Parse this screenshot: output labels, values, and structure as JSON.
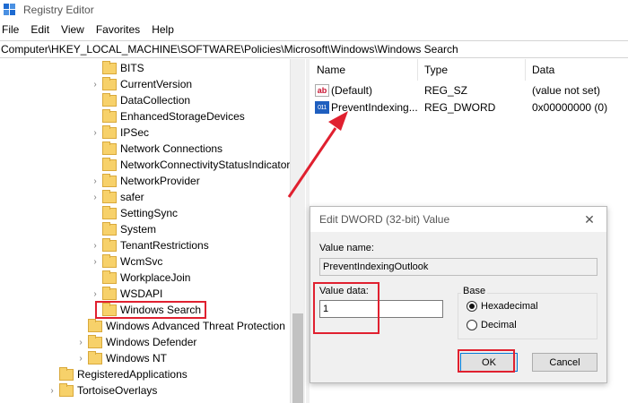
{
  "window": {
    "title": "Registry Editor"
  },
  "menu": [
    "File",
    "Edit",
    "View",
    "Favorites",
    "Help"
  ],
  "address": "Computer\\HKEY_LOCAL_MACHINE\\SOFTWARE\\Policies\\Microsoft\\Windows\\Windows Search",
  "tree": [
    {
      "label": "BITS",
      "chev": ""
    },
    {
      "label": "CurrentVersion",
      "chev": "›"
    },
    {
      "label": "DataCollection",
      "chev": ""
    },
    {
      "label": "EnhancedStorageDevices",
      "chev": ""
    },
    {
      "label": "IPSec",
      "chev": "›"
    },
    {
      "label": "Network Connections",
      "chev": ""
    },
    {
      "label": "NetworkConnectivityStatusIndicator",
      "chev": ""
    },
    {
      "label": "NetworkProvider",
      "chev": "›"
    },
    {
      "label": "safer",
      "chev": "›"
    },
    {
      "label": "SettingSync",
      "chev": ""
    },
    {
      "label": "System",
      "chev": ""
    },
    {
      "label": "TenantRestrictions",
      "chev": "›"
    },
    {
      "label": "WcmSvc",
      "chev": "›"
    },
    {
      "label": "WorkplaceJoin",
      "chev": ""
    },
    {
      "label": "WSDAPI",
      "chev": "›"
    },
    {
      "label": "Windows Search",
      "chev": ""
    },
    {
      "label": "Windows Advanced Threat Protection",
      "chev": ""
    },
    {
      "label": "Windows Defender",
      "chev": "›"
    },
    {
      "label": "Windows NT",
      "chev": "›"
    },
    {
      "label": "RegisteredApplications",
      "chev": ""
    },
    {
      "label": "TortoiseOverlays",
      "chev": "›"
    }
  ],
  "list": {
    "headers": {
      "name": "Name",
      "type": "Type",
      "data": "Data"
    },
    "rows": [
      {
        "name": "(Default)",
        "type": "REG_SZ",
        "data": "(value not set)",
        "icon": "string-value-icon"
      },
      {
        "name": "PreventIndexing...",
        "type": "REG_DWORD",
        "data": "0x00000000 (0)",
        "icon": "dword-value-icon"
      }
    ]
  },
  "dialog": {
    "title": "Edit DWORD (32-bit) Value",
    "value_name_label": "Value name:",
    "value_name": "PreventIndexingOutlook",
    "value_data_label": "Value data:",
    "value_data": "1",
    "base_label": "Base",
    "radio_hex": "Hexadecimal",
    "radio_dec": "Decimal",
    "base_selected": "Hexadecimal",
    "ok": "OK",
    "cancel": "Cancel"
  },
  "annotation_color": "#e0202f"
}
